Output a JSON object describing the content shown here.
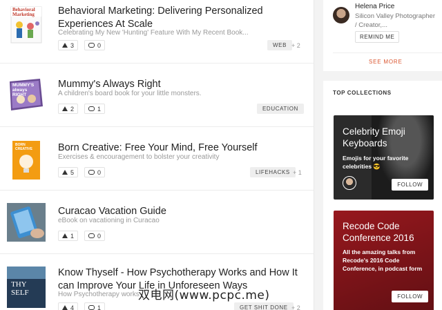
{
  "posts": [
    {
      "title": "Behavioral Marketing: Delivering Personalized Experiences At Scale",
      "tagline": "Celebrating My New 'Hunting' Feature With My Recent Book...",
      "upvotes": "3",
      "comments": "0",
      "topic": "WEB",
      "more_topics": "+ 2",
      "thumb_text": "Behavioral Marketing"
    },
    {
      "title": "Mummy's Always Right",
      "tagline": "A children's board book for your little monsters.",
      "upvotes": "2",
      "comments": "1",
      "topic": "EDUCATION",
      "more_topics": "",
      "thumb_text": "MUMMY'S always RIGHT"
    },
    {
      "title": "Born Creative: Free Your Mind, Free Yourself",
      "tagline": "Exercises & encouragement to bolster your creativity",
      "upvotes": "5",
      "comments": "0",
      "topic": "LIFEHACKS",
      "more_topics": "+ 1",
      "thumb_text": "BORN CREATIVE"
    },
    {
      "title": "Curacao Vacation Guide",
      "tagline": "eBook on vacationing in Curacao",
      "upvotes": "1",
      "comments": "0",
      "topic": "",
      "more_topics": "",
      "thumb_text": ""
    },
    {
      "title": "Know Thyself - How Psychotherapy Works and How It can Improve Your Life in Unforeseen Ways",
      "tagline": "How Psychotherapy works",
      "upvotes": "4",
      "comments": "1",
      "topic": "GET SHIT DONE",
      "more_topics": "+ 2",
      "thumb_text": "THY SELF"
    }
  ],
  "upcoming": {
    "name": "Helena Price",
    "subtitle": "Silicon Valley Photographer / Creator,...",
    "remind_label": "REMIND ME",
    "see_more": "SEE MORE"
  },
  "collections": {
    "heading": "TOP COLLECTIONS",
    "items": [
      {
        "title": "Celebrity Emoji Keyboards",
        "desc": "Emojis for your favorite celebrities 😎",
        "follow": "FOLLOW"
      },
      {
        "title": "Recode Code Conference 2016",
        "desc": "All the amazing talks from Recode's 2016 Code Conference, in podcast form",
        "follow": "FOLLOW"
      }
    ]
  },
  "watermark": "双电网(www.pcpc.me)",
  "colors": {
    "accent": "#da552f",
    "card1": "#2b2b2b",
    "card2": "#b11c23"
  }
}
